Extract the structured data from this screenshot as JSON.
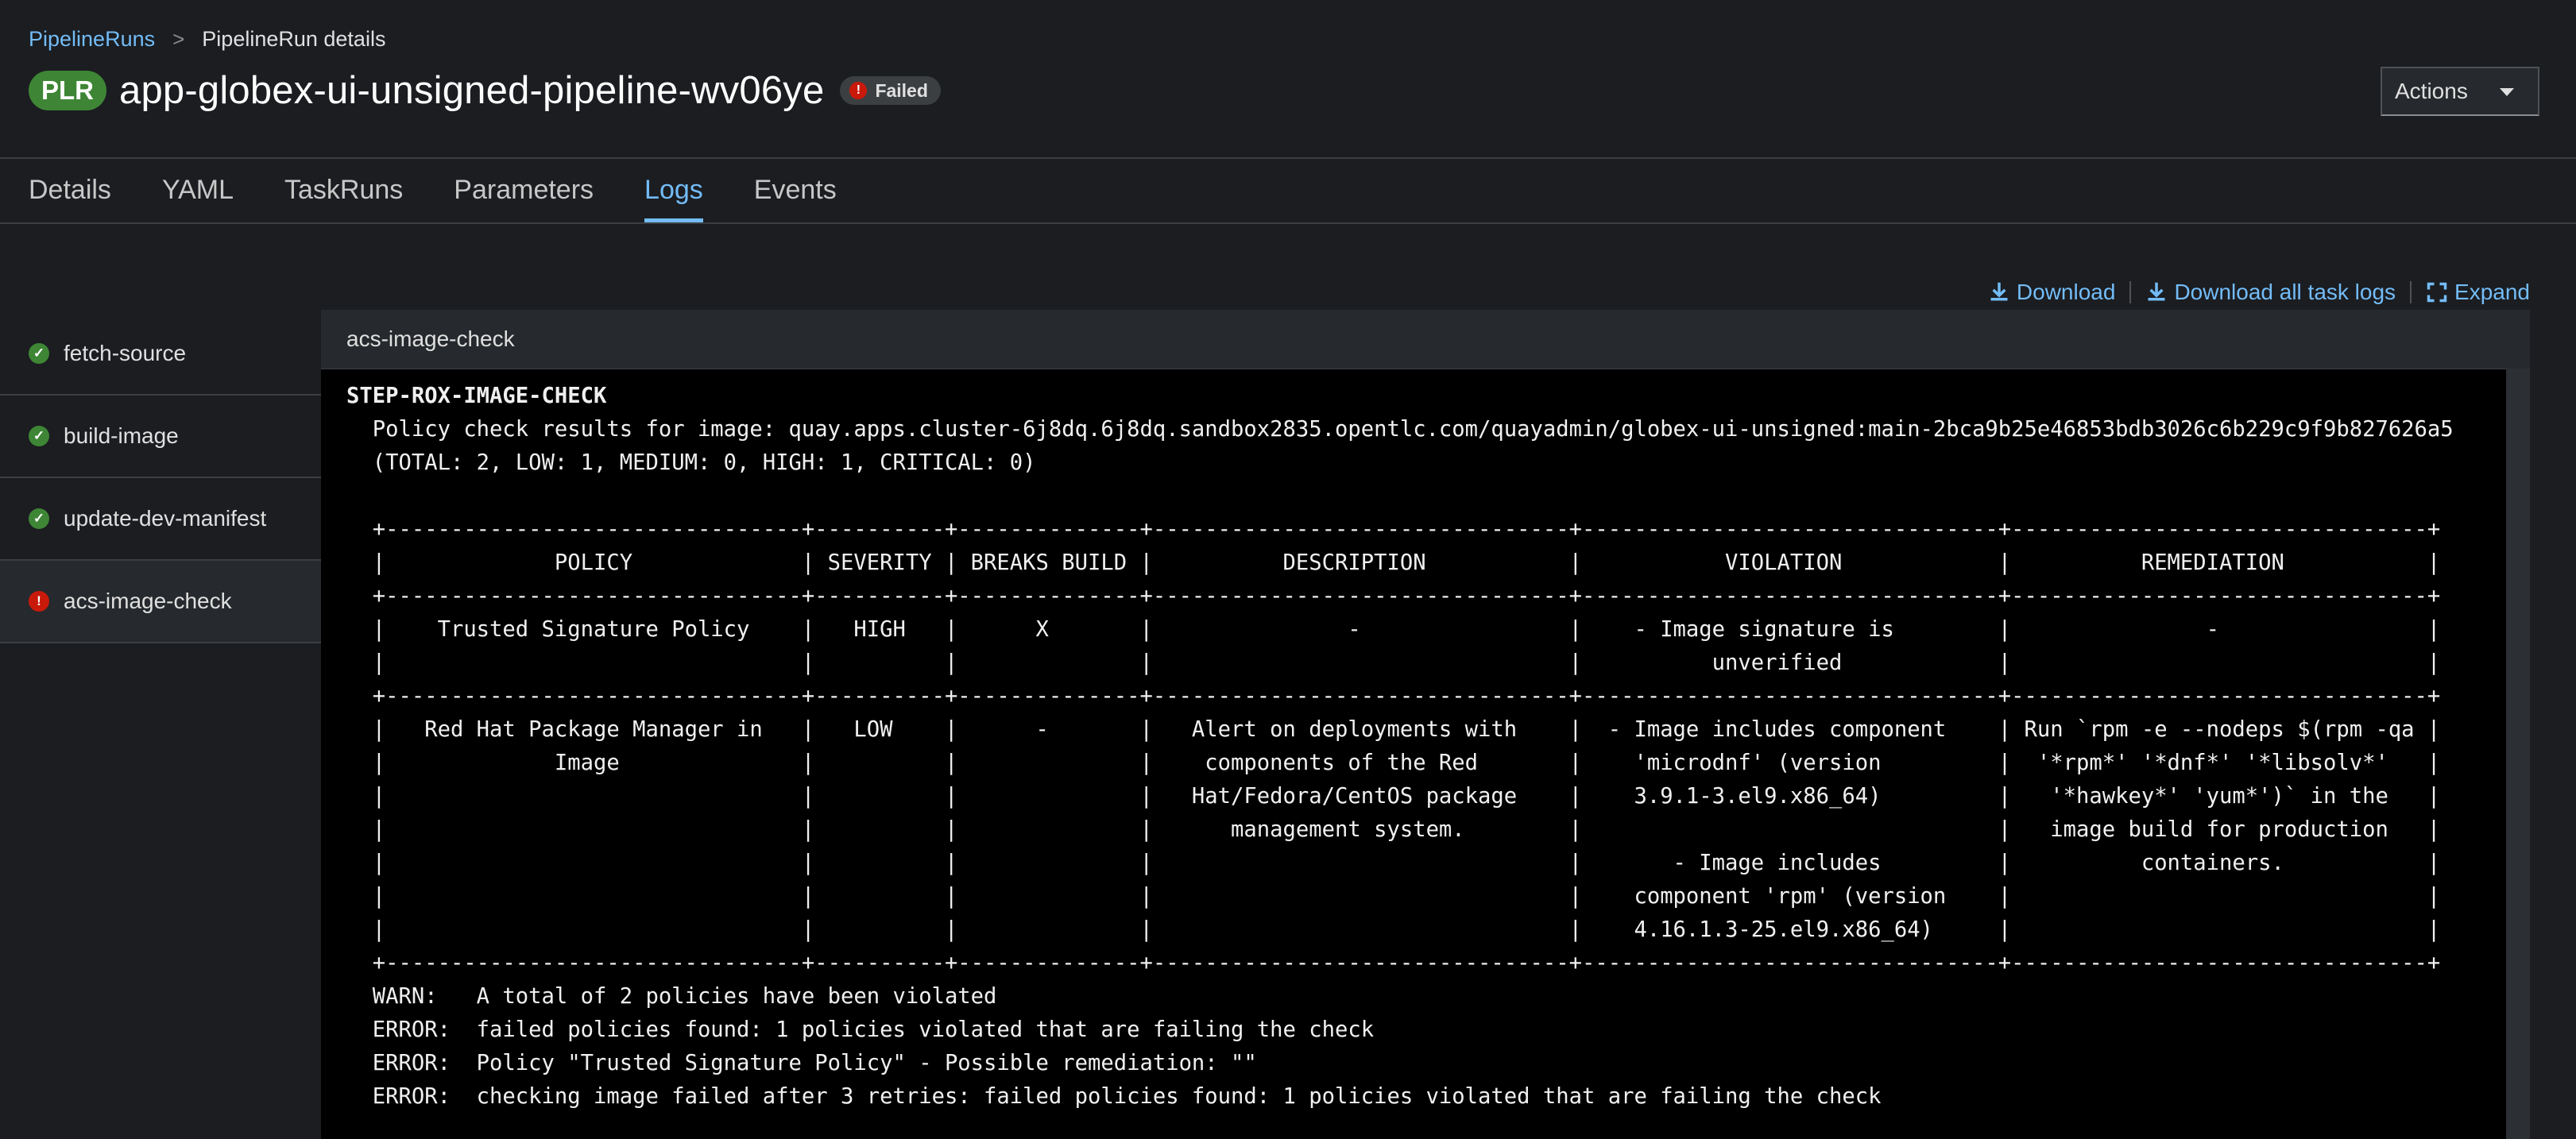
{
  "breadcrumb": {
    "parent": "PipelineRuns",
    "separator": ">",
    "current": "PipelineRun details"
  },
  "header": {
    "badge": "PLR",
    "title": "app-globex-ui-unsigned-pipeline-wv06ye",
    "status": "Failed",
    "actions_label": "Actions"
  },
  "tabs": [
    {
      "label": "Details"
    },
    {
      "label": "YAML"
    },
    {
      "label": "TaskRuns"
    },
    {
      "label": "Parameters"
    },
    {
      "label": "Logs"
    },
    {
      "label": "Events"
    }
  ],
  "toolbar": {
    "download": "Download",
    "download_all": "Download all task logs",
    "expand": "Expand"
  },
  "sidebar": {
    "items": [
      {
        "label": "fetch-source",
        "status": "success"
      },
      {
        "label": "build-image",
        "status": "success"
      },
      {
        "label": "update-dev-manifest",
        "status": "success"
      },
      {
        "label": "acs-image-check",
        "status": "failed"
      }
    ]
  },
  "log": {
    "task_title": "acs-image-check",
    "step_name": "STEP-ROX-IMAGE-CHECK",
    "lines": [
      "  Policy check results for image: quay.apps.cluster-6j8dq.6j8dq.sandbox2835.opentlc.com/quayadmin/globex-ui-unsigned:main-2bca9b25e46853bdb3026c6b229c9f9b827626a5",
      "  (TOTAL: 2, LOW: 1, MEDIUM: 0, HIGH: 1, CRITICAL: 0)",
      "",
      "  +--------------------------------+----------+--------------+--------------------------------+--------------------------------+--------------------------------+",
      "  |             POLICY             | SEVERITY | BREAKS BUILD |          DESCRIPTION           |           VIOLATION            |          REMEDIATION           |",
      "  +--------------------------------+----------+--------------+--------------------------------+--------------------------------+--------------------------------+",
      "  |    Trusted Signature Policy    |   HIGH   |      X       |               -                |    - Image signature is        |               -                |",
      "  |                                |          |              |                                |          unverified            |                                |",
      "  +--------------------------------+----------+--------------+--------------------------------+--------------------------------+--------------------------------+",
      "  |   Red Hat Package Manager in   |   LOW    |      -       |   Alert on deployments with    |  - Image includes component    | Run `rpm -e --nodeps $(rpm -qa |",
      "  |             Image              |          |              |    components of the Red       |    'microdnf' (version         |  '*rpm*' '*dnf*' '*libsolv*'   |",
      "  |                                |          |              |   Hat/Fedora/CentOS package    |    3.9.1-3.el9.x86_64)         |   '*hawkey*' 'yum*')` in the   |",
      "  |                                |          |              |      management system.        |                                |   image build for production   |",
      "  |                                |          |              |                                |       - Image includes         |          containers.           |",
      "  |                                |          |              |                                |    component 'rpm' (version    |                                |",
      "  |                                |          |              |                                |    4.16.1.3-25.el9.x86_64)     |                                |",
      "  +--------------------------------+----------+--------------+--------------------------------+--------------------------------+--------------------------------+",
      "  WARN:   A total of 2 policies have been violated",
      "  ERROR:  failed policies found: 1 policies violated that are failing the check",
      "  ERROR:  Policy \"Trusted Signature Policy\" - Possible remediation: \"\"",
      "  ERROR:  checking image failed after 3 retries: failed policies found: 1 policies violated that are failing the check"
    ]
  }
}
